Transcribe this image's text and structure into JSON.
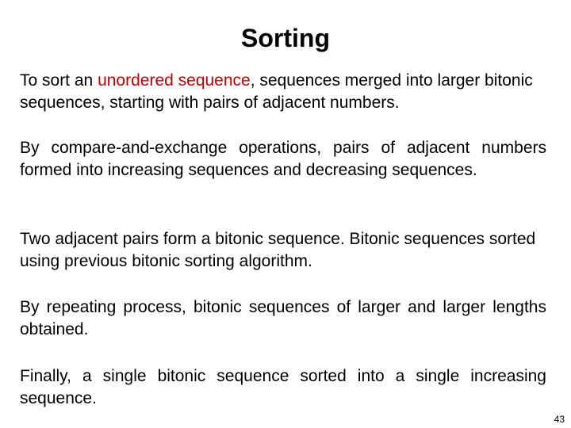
{
  "slide": {
    "title": "Sorting",
    "paragraphs": [
      {
        "pre": "To sort an ",
        "highlight": "unordered sequence",
        "post": ", sequences merged into larger bitonic sequences, starting with pairs of adjacent numbers."
      },
      {
        "text": "By compare-and-exchange operations, pairs of adjacent numbers formed into increasing sequences and decreasing sequences."
      },
      {
        "text": "Two adjacent pairs form a bitonic sequence. Bitonic sequences sorted using previous bitonic sorting algorithm."
      },
      {
        "text": "By repeating process, bitonic sequences of larger and larger lengths obtained."
      },
      {
        "text": "Finally, a single bitonic sequence sorted into a single increasing sequence."
      }
    ],
    "page_number": "43",
    "colors": {
      "highlight": "#c00000"
    }
  }
}
